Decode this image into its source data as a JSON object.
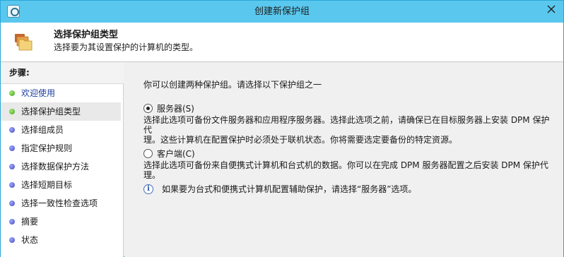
{
  "window": {
    "title": "创建新保护组"
  },
  "header": {
    "title": "选择保护组类型",
    "subtitle": "选择要为其设置保护的计算机的类型。"
  },
  "sidebar": {
    "heading": "步骤:",
    "items": [
      {
        "label": "欢迎使用",
        "status": "completed"
      },
      {
        "label": "选择保护组类型",
        "status": "current"
      },
      {
        "label": "选择组成员",
        "status": "pending"
      },
      {
        "label": "指定保护规则",
        "status": "pending"
      },
      {
        "label": "选择数据保护方法",
        "status": "pending"
      },
      {
        "label": "选择短期目标",
        "status": "pending"
      },
      {
        "label": "选择一致性检查选项",
        "status": "pending"
      },
      {
        "label": "摘要",
        "status": "pending"
      },
      {
        "label": "状态",
        "status": "pending"
      }
    ]
  },
  "main": {
    "intro": "你可以创建两种保护组。请选择以下保护组之一",
    "options": [
      {
        "label": "服务器(S)",
        "selected": true,
        "description_line1": "选择此选项可备份文件服务器和应用程序服务器。选择此选项之前，请确保已在目标服务器上安装 DPM 保护代",
        "description_line2": "理。这些计算机在配置保护时必须处于联机状态。你将需要选定要备份的特定资源。"
      },
      {
        "label": "客户端(C)",
        "selected": false,
        "description_line1": "选择此选项可备份来自便携式计算机和台式机的数据。你可以在完成 DPM 服务器配置之后安装 DPM 保护代",
        "description_line2": "理。"
      }
    ],
    "info_note": "如果要为台式和便携式计算机配置辅助保护，请选择“服务器”选项。"
  },
  "colors": {
    "titlebar": "#5ac8ee",
    "completed_dot": "#3aa31a",
    "pending_dot": "#4149b8"
  }
}
